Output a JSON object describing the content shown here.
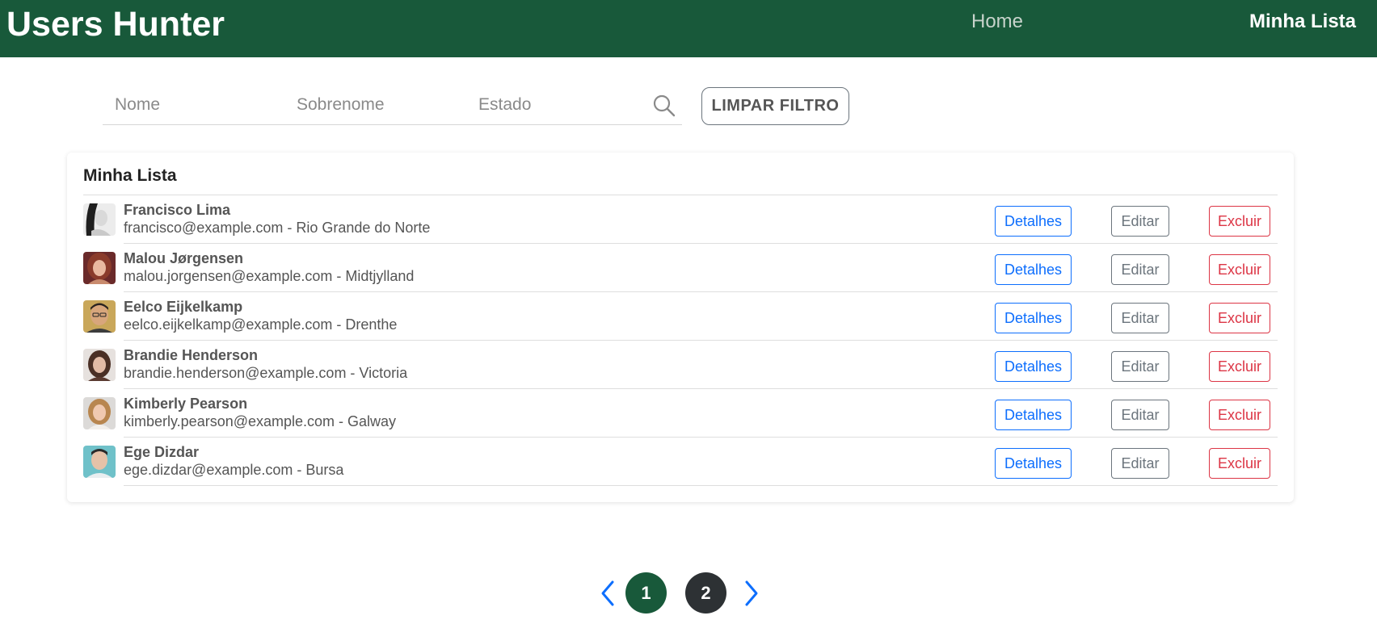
{
  "header": {
    "brand": "Users Hunter",
    "nav_home": "Home",
    "nav_list": "Minha Lista"
  },
  "filters": {
    "first_name_placeholder": "Nome",
    "last_name_placeholder": "Sobrenome",
    "state_placeholder": "Estado",
    "clear_label": "LIMPAR FILTRO"
  },
  "list": {
    "title": "Minha Lista",
    "details_label": "Detalhes",
    "edit_label": "Editar",
    "delete_label": "Excluir",
    "users": [
      {
        "name": "Francisco Lima",
        "subtitle": "francisco@example.com - Rio Grande do Norte"
      },
      {
        "name": "Malou Jørgensen",
        "subtitle": "malou.jorgensen@example.com - Midtjylland"
      },
      {
        "name": "Eelco Eijkelkamp",
        "subtitle": "eelco.eijkelkamp@example.com - Drenthe"
      },
      {
        "name": "Brandie Henderson",
        "subtitle": "brandie.henderson@example.com - Victoria"
      },
      {
        "name": "Kimberly Pearson",
        "subtitle": "kimberly.pearson@example.com - Galway"
      },
      {
        "name": "Ege Dizdar",
        "subtitle": "ege.dizdar@example.com - Bursa"
      }
    ]
  },
  "pagination": {
    "pages": [
      "1",
      "2"
    ],
    "active": "1"
  },
  "colors": {
    "brand_green": "#18593a",
    "primary_blue": "#0d6efd",
    "secondary_gray": "#6c757d",
    "danger_red": "#dc3545",
    "dark_page": "#2d3134"
  }
}
